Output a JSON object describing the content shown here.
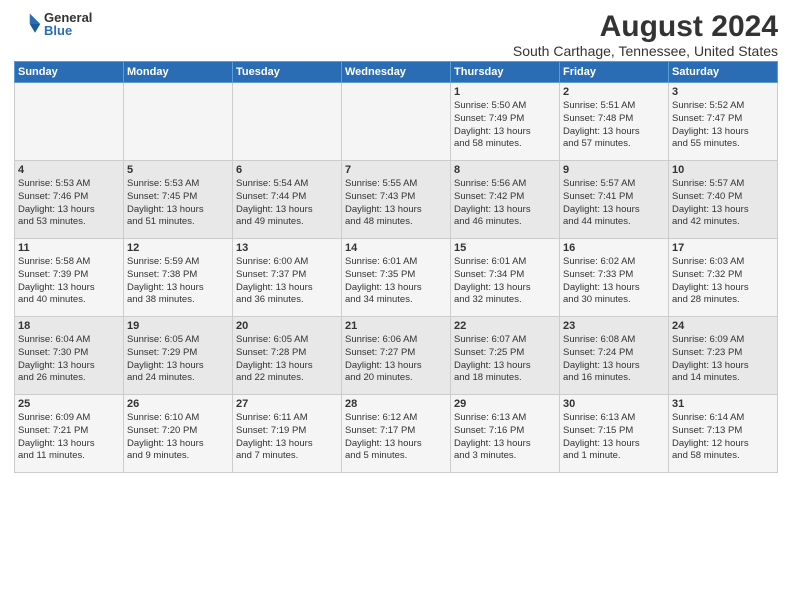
{
  "header": {
    "logo_general": "General",
    "logo_blue": "Blue",
    "title": "August 2024",
    "subtitle": "South Carthage, Tennessee, United States"
  },
  "days_of_week": [
    "Sunday",
    "Monday",
    "Tuesday",
    "Wednesday",
    "Thursday",
    "Friday",
    "Saturday"
  ],
  "weeks": [
    [
      {
        "day": "",
        "info": ""
      },
      {
        "day": "",
        "info": ""
      },
      {
        "day": "",
        "info": ""
      },
      {
        "day": "",
        "info": ""
      },
      {
        "day": "1",
        "info": "Sunrise: 5:50 AM\nSunset: 7:49 PM\nDaylight: 13 hours\nand 58 minutes."
      },
      {
        "day": "2",
        "info": "Sunrise: 5:51 AM\nSunset: 7:48 PM\nDaylight: 13 hours\nand 57 minutes."
      },
      {
        "day": "3",
        "info": "Sunrise: 5:52 AM\nSunset: 7:47 PM\nDaylight: 13 hours\nand 55 minutes."
      }
    ],
    [
      {
        "day": "4",
        "info": "Sunrise: 5:53 AM\nSunset: 7:46 PM\nDaylight: 13 hours\nand 53 minutes."
      },
      {
        "day": "5",
        "info": "Sunrise: 5:53 AM\nSunset: 7:45 PM\nDaylight: 13 hours\nand 51 minutes."
      },
      {
        "day": "6",
        "info": "Sunrise: 5:54 AM\nSunset: 7:44 PM\nDaylight: 13 hours\nand 49 minutes."
      },
      {
        "day": "7",
        "info": "Sunrise: 5:55 AM\nSunset: 7:43 PM\nDaylight: 13 hours\nand 48 minutes."
      },
      {
        "day": "8",
        "info": "Sunrise: 5:56 AM\nSunset: 7:42 PM\nDaylight: 13 hours\nand 46 minutes."
      },
      {
        "day": "9",
        "info": "Sunrise: 5:57 AM\nSunset: 7:41 PM\nDaylight: 13 hours\nand 44 minutes."
      },
      {
        "day": "10",
        "info": "Sunrise: 5:57 AM\nSunset: 7:40 PM\nDaylight: 13 hours\nand 42 minutes."
      }
    ],
    [
      {
        "day": "11",
        "info": "Sunrise: 5:58 AM\nSunset: 7:39 PM\nDaylight: 13 hours\nand 40 minutes."
      },
      {
        "day": "12",
        "info": "Sunrise: 5:59 AM\nSunset: 7:38 PM\nDaylight: 13 hours\nand 38 minutes."
      },
      {
        "day": "13",
        "info": "Sunrise: 6:00 AM\nSunset: 7:37 PM\nDaylight: 13 hours\nand 36 minutes."
      },
      {
        "day": "14",
        "info": "Sunrise: 6:01 AM\nSunset: 7:35 PM\nDaylight: 13 hours\nand 34 minutes."
      },
      {
        "day": "15",
        "info": "Sunrise: 6:01 AM\nSunset: 7:34 PM\nDaylight: 13 hours\nand 32 minutes."
      },
      {
        "day": "16",
        "info": "Sunrise: 6:02 AM\nSunset: 7:33 PM\nDaylight: 13 hours\nand 30 minutes."
      },
      {
        "day": "17",
        "info": "Sunrise: 6:03 AM\nSunset: 7:32 PM\nDaylight: 13 hours\nand 28 minutes."
      }
    ],
    [
      {
        "day": "18",
        "info": "Sunrise: 6:04 AM\nSunset: 7:30 PM\nDaylight: 13 hours\nand 26 minutes."
      },
      {
        "day": "19",
        "info": "Sunrise: 6:05 AM\nSunset: 7:29 PM\nDaylight: 13 hours\nand 24 minutes."
      },
      {
        "day": "20",
        "info": "Sunrise: 6:05 AM\nSunset: 7:28 PM\nDaylight: 13 hours\nand 22 minutes."
      },
      {
        "day": "21",
        "info": "Sunrise: 6:06 AM\nSunset: 7:27 PM\nDaylight: 13 hours\nand 20 minutes."
      },
      {
        "day": "22",
        "info": "Sunrise: 6:07 AM\nSunset: 7:25 PM\nDaylight: 13 hours\nand 18 minutes."
      },
      {
        "day": "23",
        "info": "Sunrise: 6:08 AM\nSunset: 7:24 PM\nDaylight: 13 hours\nand 16 minutes."
      },
      {
        "day": "24",
        "info": "Sunrise: 6:09 AM\nSunset: 7:23 PM\nDaylight: 13 hours\nand 14 minutes."
      }
    ],
    [
      {
        "day": "25",
        "info": "Sunrise: 6:09 AM\nSunset: 7:21 PM\nDaylight: 13 hours\nand 11 minutes."
      },
      {
        "day": "26",
        "info": "Sunrise: 6:10 AM\nSunset: 7:20 PM\nDaylight: 13 hours\nand 9 minutes."
      },
      {
        "day": "27",
        "info": "Sunrise: 6:11 AM\nSunset: 7:19 PM\nDaylight: 13 hours\nand 7 minutes."
      },
      {
        "day": "28",
        "info": "Sunrise: 6:12 AM\nSunset: 7:17 PM\nDaylight: 13 hours\nand 5 minutes."
      },
      {
        "day": "29",
        "info": "Sunrise: 6:13 AM\nSunset: 7:16 PM\nDaylight: 13 hours\nand 3 minutes."
      },
      {
        "day": "30",
        "info": "Sunrise: 6:13 AM\nSunset: 7:15 PM\nDaylight: 13 hours\nand 1 minute."
      },
      {
        "day": "31",
        "info": "Sunrise: 6:14 AM\nSunset: 7:13 PM\nDaylight: 12 hours\nand 58 minutes."
      }
    ]
  ]
}
